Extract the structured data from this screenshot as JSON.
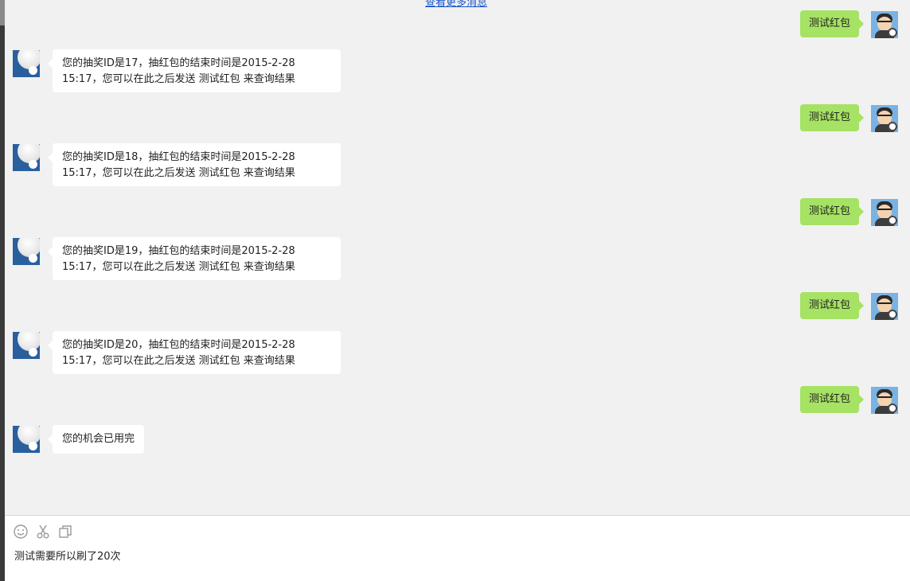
{
  "header": {
    "more_messages_link": "查看更多消息"
  },
  "messages": [
    {
      "from": "user",
      "text": "测试红包"
    },
    {
      "from": "bot",
      "text": "您的抽奖ID是17，抽红包的结束时间是2015-2-28 15:17，您可以在此之后发送 测试红包 来查询结果"
    },
    {
      "from": "user",
      "text": "测试红包"
    },
    {
      "from": "bot",
      "text": "您的抽奖ID是18，抽红包的结束时间是2015-2-28 15:17，您可以在此之后发送 测试红包 来查询结果"
    },
    {
      "from": "user",
      "text": "测试红包"
    },
    {
      "from": "bot",
      "text": "您的抽奖ID是19，抽红包的结束时间是2015-2-28 15:17，您可以在此之后发送 测试红包 来查询结果"
    },
    {
      "from": "user",
      "text": "测试红包"
    },
    {
      "from": "bot",
      "text": "您的抽奖ID是20，抽红包的结束时间是2015-2-28 15:17，您可以在此之后发送 测试红包 来查询结果"
    },
    {
      "from": "user",
      "text": "测试红包"
    },
    {
      "from": "bot",
      "text": "您的机会已用完"
    }
  ],
  "input": {
    "value": "测试需要所以刷了20次"
  },
  "toolbar": {
    "icons": [
      "emoji-icon",
      "scissors-icon",
      "copy-window-icon"
    ]
  },
  "colors": {
    "chat_background": "#f1f1f1",
    "user_bubble": "#a6e263",
    "bot_bubble": "#ffffff",
    "link": "#1a56c8"
  }
}
